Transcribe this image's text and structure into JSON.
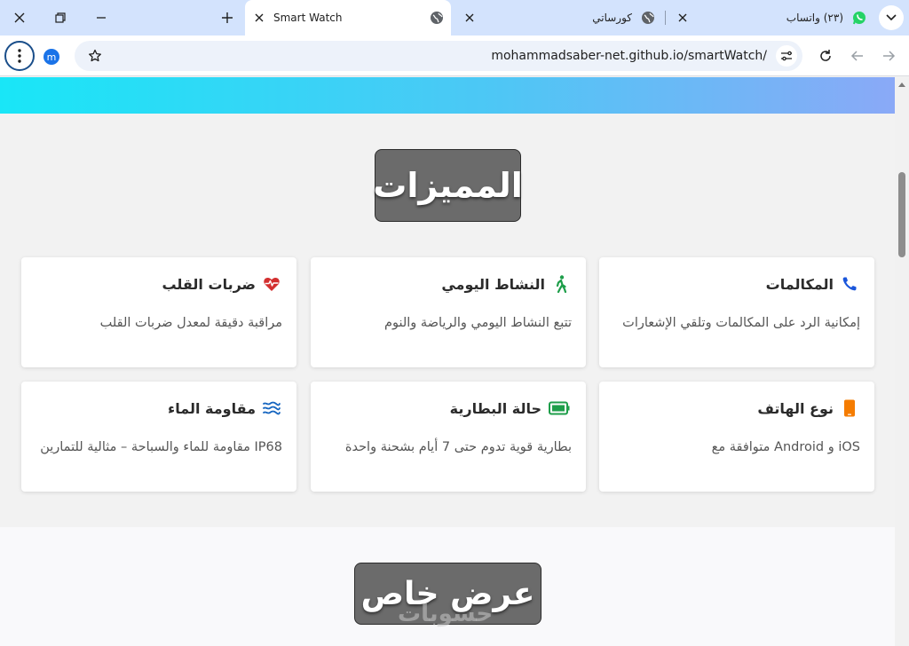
{
  "browser": {
    "tabs": [
      {
        "label": "(٢٣) واتساب",
        "favicon": "whatsapp-icon",
        "active": false
      },
      {
        "label": "كورساتي",
        "favicon": "globe-icon",
        "active": false
      },
      {
        "label": "Smart Watch",
        "favicon": "globe-icon",
        "active": true
      }
    ],
    "url": "mohammadsaber-net.github.io/smartWatch/",
    "profile_initial": "m"
  },
  "features": {
    "title": "المميزات",
    "cards": [
      {
        "title": "المكالمات",
        "icon": "phone-icon",
        "icon_color": "#1a56db",
        "desc": "إمكانية الرد على المكالمات وتلقي الإشعارات"
      },
      {
        "title": "النشاط اليومي",
        "icon": "walking-person-icon",
        "icon_color": "#1e9e4a",
        "desc": "تتبع النشاط اليومي والرياضة والنوم"
      },
      {
        "title": "ضربات القلب",
        "icon": "heart-pulse-icon",
        "icon_color": "#d32f2f",
        "desc": "مراقبة دقيقة لمعدل ضربات القلب"
      },
      {
        "title": "نوع الهاتف",
        "icon": "mobile-phone-icon",
        "icon_color": "#f57c00",
        "desc": "iOS و Android متوافقة مع"
      },
      {
        "title": "حالة البطارية",
        "icon": "battery-full-icon",
        "icon_color": "#1e9e4a",
        "desc": "بطارية قوية تدوم حتى 7 أيام بشحنة واحدة"
      },
      {
        "title": "مقاومة الماء",
        "icon": "water-waves-icon",
        "icon_color": "#1565c0",
        "desc": "IP68 مقاومة للماء والسباحة – مثالية للتمارين"
      }
    ]
  },
  "offer": {
    "title": "عرض خاص"
  },
  "watermark": "حسوبات",
  "colors": {
    "tab_strip": "#d3e3fd",
    "section_title_bg": "#6b6b6b",
    "hero_gradient_start": "#19e6f7",
    "hero_gradient_end": "#8aa9f7"
  }
}
